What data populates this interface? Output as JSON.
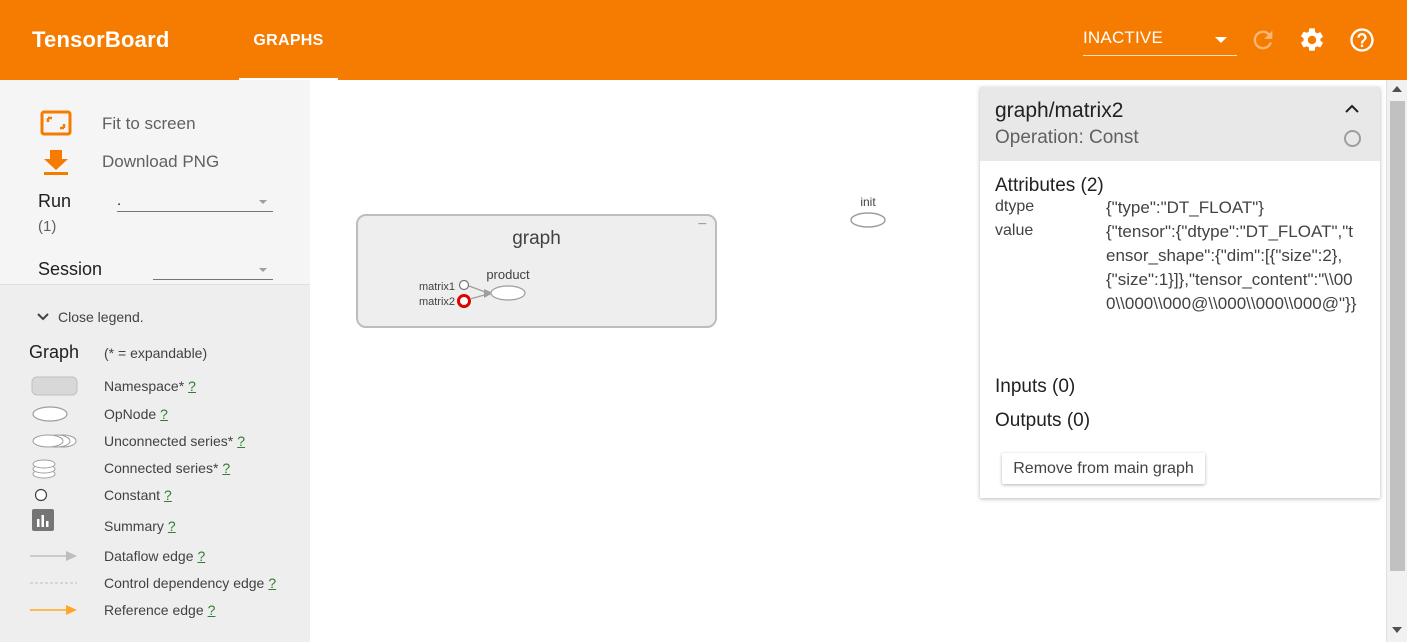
{
  "header": {
    "brand": "TensorBoard",
    "tabs": [
      {
        "label": "GRAPHS",
        "active": true
      }
    ],
    "status_select": {
      "value": "INACTIVE"
    },
    "icons": [
      "reload-icon",
      "settings-icon",
      "help-icon"
    ],
    "accent_color": "#f57c00"
  },
  "sidebar": {
    "fit_to_screen": "Fit to screen",
    "download_png": "Download PNG",
    "run": {
      "label": "Run",
      "count": "(1)",
      "value": "."
    },
    "session": {
      "label": "Session",
      "value": ""
    }
  },
  "legend": {
    "close_label": "Close legend.",
    "title": "Graph",
    "note": "(* = expandable)",
    "items": [
      {
        "label": "Namespace*",
        "help": "?",
        "symbol": "namespace"
      },
      {
        "label": "OpNode",
        "help": "?",
        "symbol": "opnode"
      },
      {
        "label": "Unconnected series*",
        "help": "?",
        "symbol": "unconnected-series"
      },
      {
        "label": "Connected series*",
        "help": "?",
        "symbol": "connected-series"
      },
      {
        "label": "Constant",
        "help": "?",
        "symbol": "constant"
      },
      {
        "label": "Summary",
        "help": "?",
        "symbol": "summary"
      },
      {
        "label": "Dataflow edge",
        "help": "?",
        "symbol": "dataflow-edge"
      },
      {
        "label": "Control dependency edge",
        "help": "?",
        "symbol": "control-edge"
      },
      {
        "label": "Reference edge",
        "help": "?",
        "symbol": "reference-edge"
      }
    ]
  },
  "graph": {
    "namespace": {
      "title": "graph",
      "collapse": "−"
    },
    "nodes": {
      "matrix1": "matrix1",
      "matrix2": "matrix2",
      "product": "product",
      "init": "init"
    }
  },
  "info_card": {
    "title": "graph/matrix2",
    "subtitle": "Operation: Const",
    "attributes_title": "Attributes (2)",
    "attributes": [
      {
        "key": "dtype",
        "value": "{\"type\":\"DT_FLOAT\"}"
      },
      {
        "key": "value",
        "value": "{\"tensor\":{\"dtype\":\"DT_FLOAT\",\"tensor_shape\":{\"dim\":[{\"size\":2},{\"size\":1}]},\"tensor_content\":\"\\\\000\\\\000\\\\000@\\\\000\\\\000\\\\000@\"}}"
      }
    ],
    "inputs_title": "Inputs (0)",
    "outputs_title": "Outputs (0)",
    "remove_button": "Remove from main graph"
  }
}
